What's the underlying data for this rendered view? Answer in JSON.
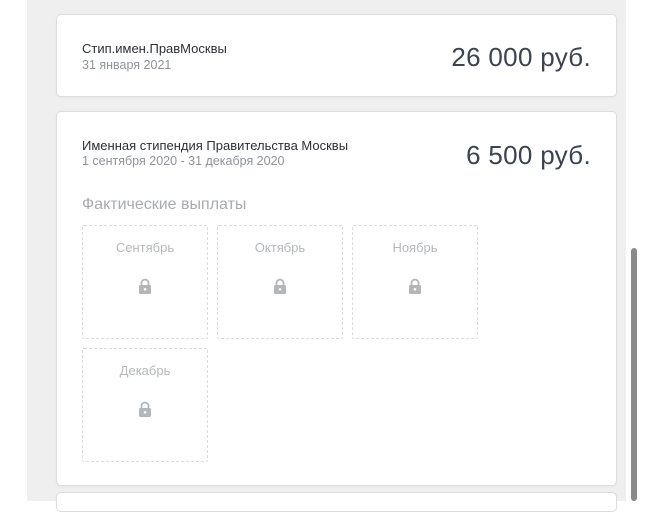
{
  "scholarships": [
    {
      "title": "Стип.имен.ПравМосквы",
      "date": "31 января 2021",
      "amount": "26 000 руб."
    },
    {
      "title": "Именная стипендия Правительства Москвы",
      "date": "1 сентября 2020 - 31 декабря 2020",
      "amount": "6 500 руб.",
      "payments_title": "Фактические выплаты",
      "months": [
        {
          "label": "Сентябрь",
          "icon": "lock-icon"
        },
        {
          "label": "Октябрь",
          "icon": "lock-icon"
        },
        {
          "label": "Ноябрь",
          "icon": "lock-icon"
        },
        {
          "label": "Декабрь",
          "icon": "lock-icon"
        }
      ]
    }
  ],
  "colors": {
    "background_panel": "#efefef",
    "card_border": "#dddddd",
    "amount_text": "#3b4250",
    "muted_text": "#8e939c",
    "locked_text": "#b5b8bd",
    "lock_icon": "#b3b6bb",
    "scrollbar": "#8a8a8a"
  }
}
